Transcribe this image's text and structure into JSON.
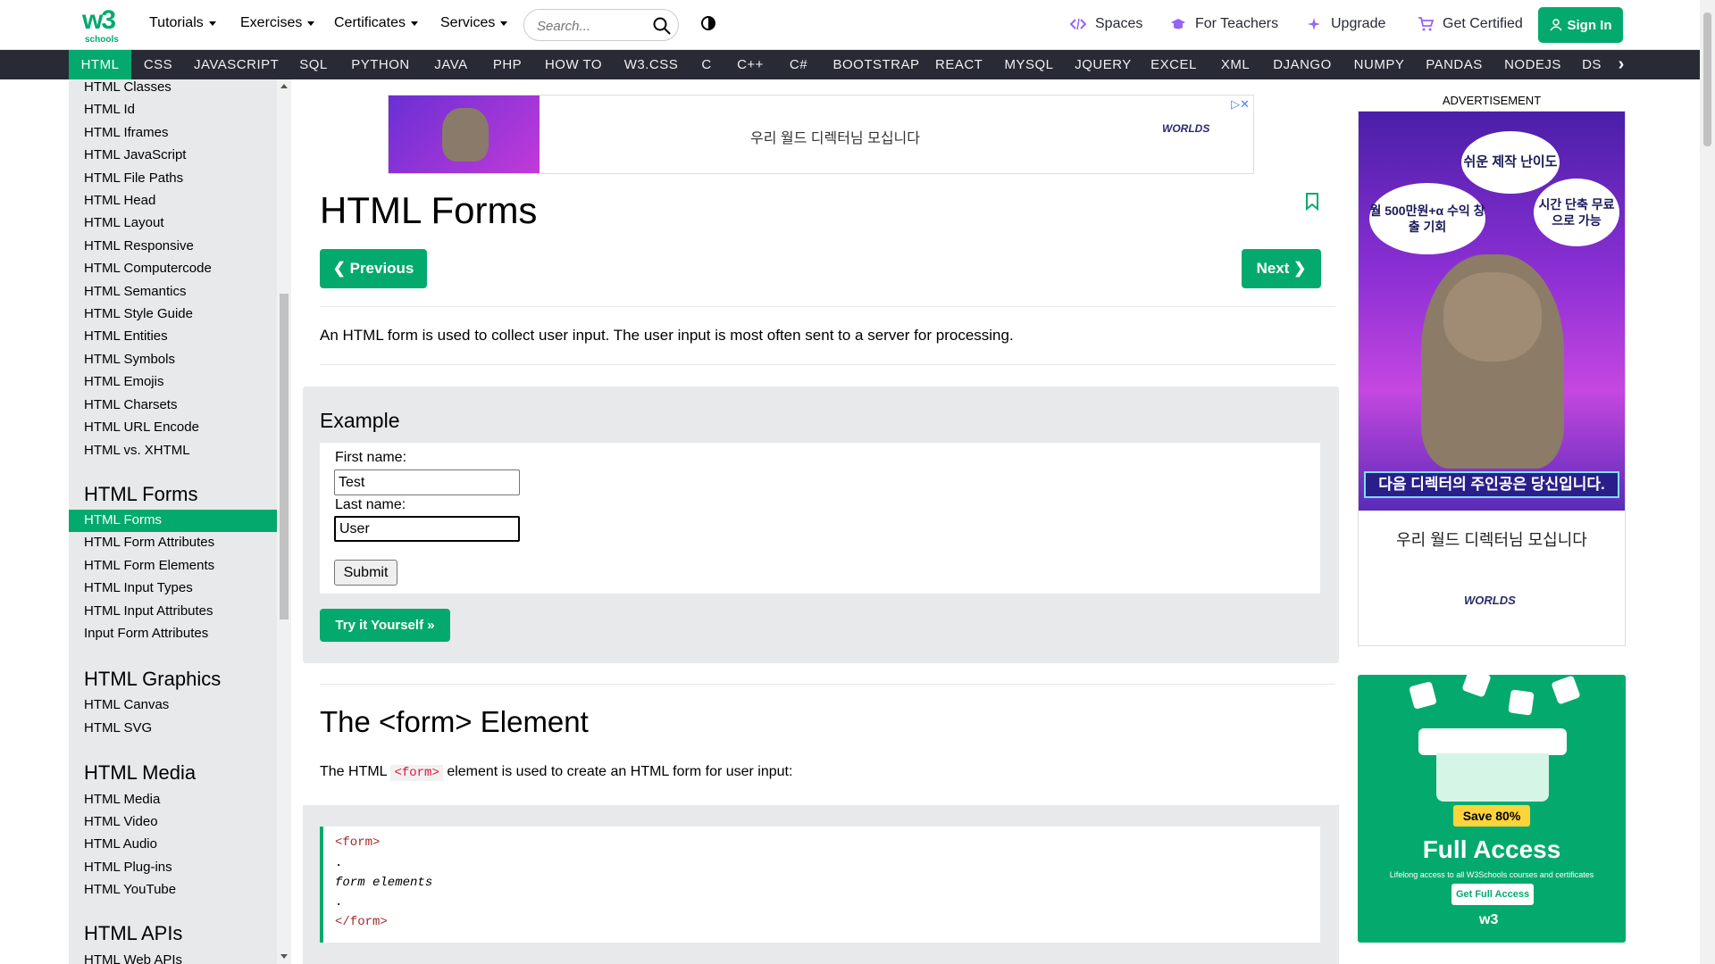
{
  "topbar": {
    "logo_text": "w3",
    "logo_sup": "3",
    "logo_sub": "schools",
    "menus": [
      {
        "label": "Tutorials"
      },
      {
        "label": "Exercises"
      },
      {
        "label": "Certificates"
      },
      {
        "label": "Services"
      }
    ],
    "search_placeholder": "Search...",
    "right_links": [
      {
        "label": "Spaces",
        "icon": "code-icon"
      },
      {
        "label": "For Teachers",
        "icon": "graduation-cap-icon"
      },
      {
        "label": "Upgrade",
        "icon": "sparkle-icon"
      },
      {
        "label": "Get Certified",
        "icon": "cart-icon"
      }
    ],
    "signin_label": "Sign In"
  },
  "subnav": {
    "items": [
      "HTML",
      "CSS",
      "JAVASCRIPT",
      "SQL",
      "PYTHON",
      "JAVA",
      "PHP",
      "HOW TO",
      "W3.CSS",
      "C",
      "C++",
      "C#",
      "BOOTSTRAP",
      "REACT",
      "MYSQL",
      "JQUERY",
      "EXCEL",
      "XML",
      "DJANGO",
      "NUMPY",
      "PANDAS",
      "NODEJS",
      "DS"
    ],
    "active": "HTML"
  },
  "sidebar": {
    "links_top": [
      "HTML Classes",
      "HTML Id",
      "HTML Iframes",
      "HTML JavaScript",
      "HTML File Paths",
      "HTML Head",
      "HTML Layout",
      "HTML Responsive",
      "HTML Computercode",
      "HTML Semantics",
      "HTML Style Guide",
      "HTML Entities",
      "HTML Symbols",
      "HTML Emojis",
      "HTML Charsets",
      "HTML URL Encode",
      "HTML vs. XHTML"
    ],
    "forms_heading": "HTML Forms",
    "forms_links": [
      "HTML Forms",
      "HTML Form Attributes",
      "HTML Form Elements",
      "HTML Input Types",
      "HTML Input Attributes",
      "Input Form Attributes"
    ],
    "graphics_heading": "HTML Graphics",
    "graphics_links": [
      "HTML Canvas",
      "HTML SVG"
    ],
    "media_heading": "HTML Media",
    "media_links": [
      "HTML Media",
      "HTML Video",
      "HTML Audio",
      "HTML Plug-ins",
      "HTML YouTube"
    ],
    "apis_heading": "HTML APIs",
    "apis_links": [
      "HTML Web APIs"
    ]
  },
  "main": {
    "ad_text": "우리 월드 디렉터님 모십니다",
    "ad_logo": "WORLDS",
    "title": "HTML Forms",
    "prev_label": "❮ Previous",
    "next_label": "Next ❯",
    "intro": "An HTML form is used to collect user input. The user input is most often sent to a server for processing.",
    "example": {
      "title": "Example",
      "first_label": "First name:",
      "first_value": "Test",
      "last_label": "Last name:",
      "last_value": "User",
      "submit_label": "Submit",
      "try_label": "Try it Yourself »"
    },
    "section_title": "The <form> Element",
    "section_desc_before": "The HTML",
    "section_desc_code": "<form>",
    "section_desc_after": "element is used to create an HTML form for user input:",
    "code_lines": [
      "<form>",
      ".",
      "form elements",
      ".",
      "</form>"
    ]
  },
  "right": {
    "ad_label": "ADVERTISEMENT",
    "ad_bubble1": "쉬운 제작 난이도",
    "ad_bubble2": "월 500만원+α 수익 창출 기회",
    "ad_bubble3": "시간 단축 무료으로 가능",
    "ad_banner": "다음 디렉터의 주인공은 당신입니다.",
    "ad_text": "우리 월드 디렉터님 모십니다",
    "ad_logo": "WORLDS",
    "promo_save": "Save 80%",
    "promo_title": "Full Access",
    "promo_sub": "Lifelong access to all W3Schools courses and certificates",
    "promo_btn": "Get Full Access",
    "promo_logo": "w3"
  },
  "colors": {
    "brand": "#04aa6d",
    "navbar": "#282a35",
    "sidebar": "#e7e9eb"
  }
}
